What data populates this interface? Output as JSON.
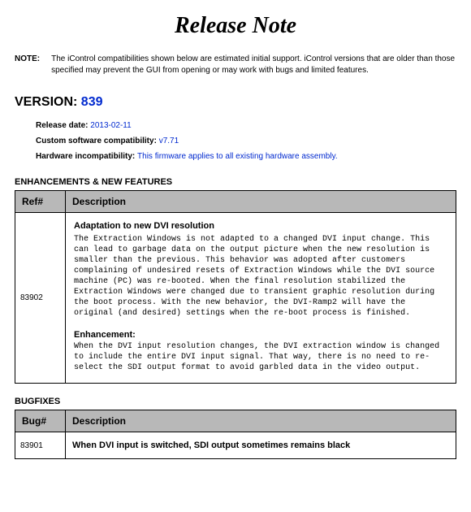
{
  "title": "Release Note",
  "note": {
    "label": "NOTE:",
    "text": "The iControl compatibilities shown below are estimated initial support.  iControl versions that are older than those specified may prevent the GUI from opening or may work with bugs and limited features."
  },
  "version": {
    "prefix": "VERSION: ",
    "number": "839"
  },
  "meta": {
    "release_date_label": "Release date: ",
    "release_date": "2013-02-11",
    "compat_label": "Custom software compatibility: ",
    "compat": "v7.71",
    "hw_label": "Hardware incompatibility: ",
    "hw": "This firmware applies to all existing hardware assembly."
  },
  "enh": {
    "heading": "ENHANCEMENTS & NEW FEATURES",
    "col_ref": "Ref#",
    "col_desc": "Description",
    "rows": [
      {
        "ref": "83902",
        "title": "Adaptation to new DVI resolution",
        "body": "The Extraction Windows is not adapted to a changed DVI input change.  This can lead to garbage data on the output picture when the new resolution is smaller than the previous.  This behavior was adopted after customers complaining of undesired resets of Extraction Windows while the DVI source machine (PC) was re-booted.  When the final resolution stabilized the Extraction Windows were changed due to transient graphic resolution during the boot process.  With the new behavior, the DVI-Ramp2 will have the original (and desired) settings when the re-boot process is finished.",
        "subhead": "Enhancement:",
        "body2": "When the DVI input resolution changes, the DVI extraction window is changed to include the entire DVI input signal.  That way, there is no need to re-select the SDI output format to avoid garbled data in the video output."
      }
    ]
  },
  "bug": {
    "heading": "BUGFIXES",
    "col_ref": "Bug#",
    "col_desc": "Description",
    "rows": [
      {
        "ref": "83901",
        "desc": "When DVI input is switched, SDI output sometimes remains black"
      }
    ]
  }
}
